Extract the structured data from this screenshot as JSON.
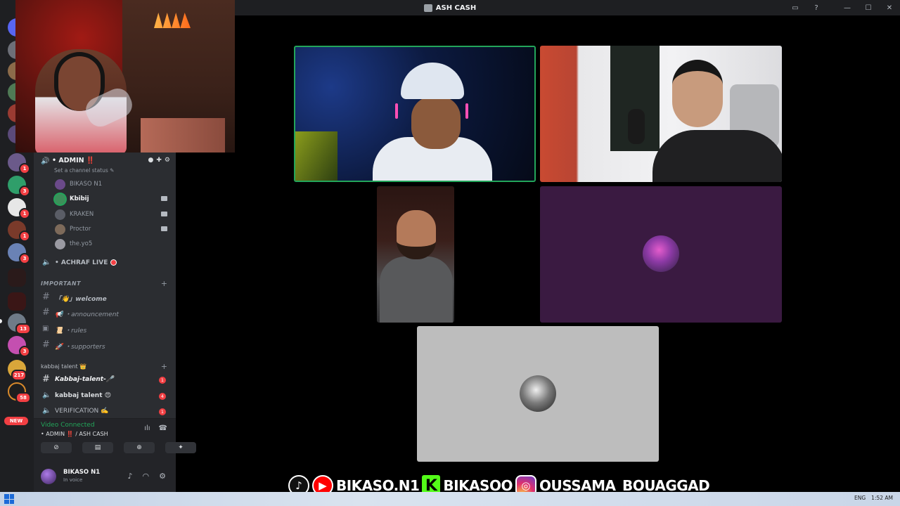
{
  "window": {
    "title": "ASH CASH",
    "controls": [
      "▭",
      "?",
      "—",
      "☐",
      "✕"
    ]
  },
  "rail": {
    "badges": [
      {
        "value": "1"
      },
      {
        "value": "3"
      },
      {
        "value": "1"
      },
      {
        "value": "1"
      },
      {
        "value": "3"
      },
      {
        "value": "13"
      },
      {
        "value": "3"
      },
      {
        "value": "217"
      },
      {
        "value": "58"
      }
    ],
    "new_label": "NEW"
  },
  "voice_channel": {
    "name": "• ADMIN ‼️",
    "status_placeholder": "Set a channel status ✎",
    "members": [
      {
        "name": "BIKASO N1",
        "active": false,
        "camera": false,
        "color": "#6b4a8a"
      },
      {
        "name": "Kbibij",
        "active": true,
        "camera": true,
        "color": "#3d8f5a"
      },
      {
        "name": "KRAKEN",
        "active": false,
        "camera": true,
        "color": "#5a5d66"
      },
      {
        "name": "Proctor",
        "active": false,
        "camera": true,
        "color": "#7d6a5a"
      },
      {
        "name": "the.yo5",
        "active": false,
        "camera": false,
        "color": "#9a9aa2"
      }
    ]
  },
  "live_channel": {
    "name": "• ACHRAF LIVE"
  },
  "categories": {
    "important": "IMPORTANT",
    "kabbaj": "kabbaj talent 👑"
  },
  "channels": {
    "welcome": "「👋」welcome",
    "announcement": "📢 ・announcement",
    "rules": "📜 ・rules",
    "supporters": "🚀 ・supporters",
    "kabbaj_talent_text": "Kabbaj-talent-🎤",
    "kabbaj_talent_voice": "kabbaj talent 😍",
    "verification": "VERIFICATION ✍️",
    "counts": {
      "kabbaj_text": "1",
      "kabbaj_voice": "4",
      "verification": "1"
    }
  },
  "voice_panel": {
    "status": "Video Connected",
    "location": "• ADMIN ‼️ / ASH CASH"
  },
  "user_panel": {
    "username": "BIKASO N1",
    "status": "In voice"
  },
  "social_overlay": {
    "handle1": "BIKASO.N1",
    "handle2": "BIKASOO",
    "handle3": "OUSSAMA_BOUAGGAD",
    "kick_letter": "K"
  },
  "taskbar": {
    "language": "ENG",
    "time": "1:52 AM"
  },
  "colors": {
    "speaking_border": "#23a55a",
    "mention_badge": "#f23f43",
    "kick_green": "#53fc18"
  }
}
